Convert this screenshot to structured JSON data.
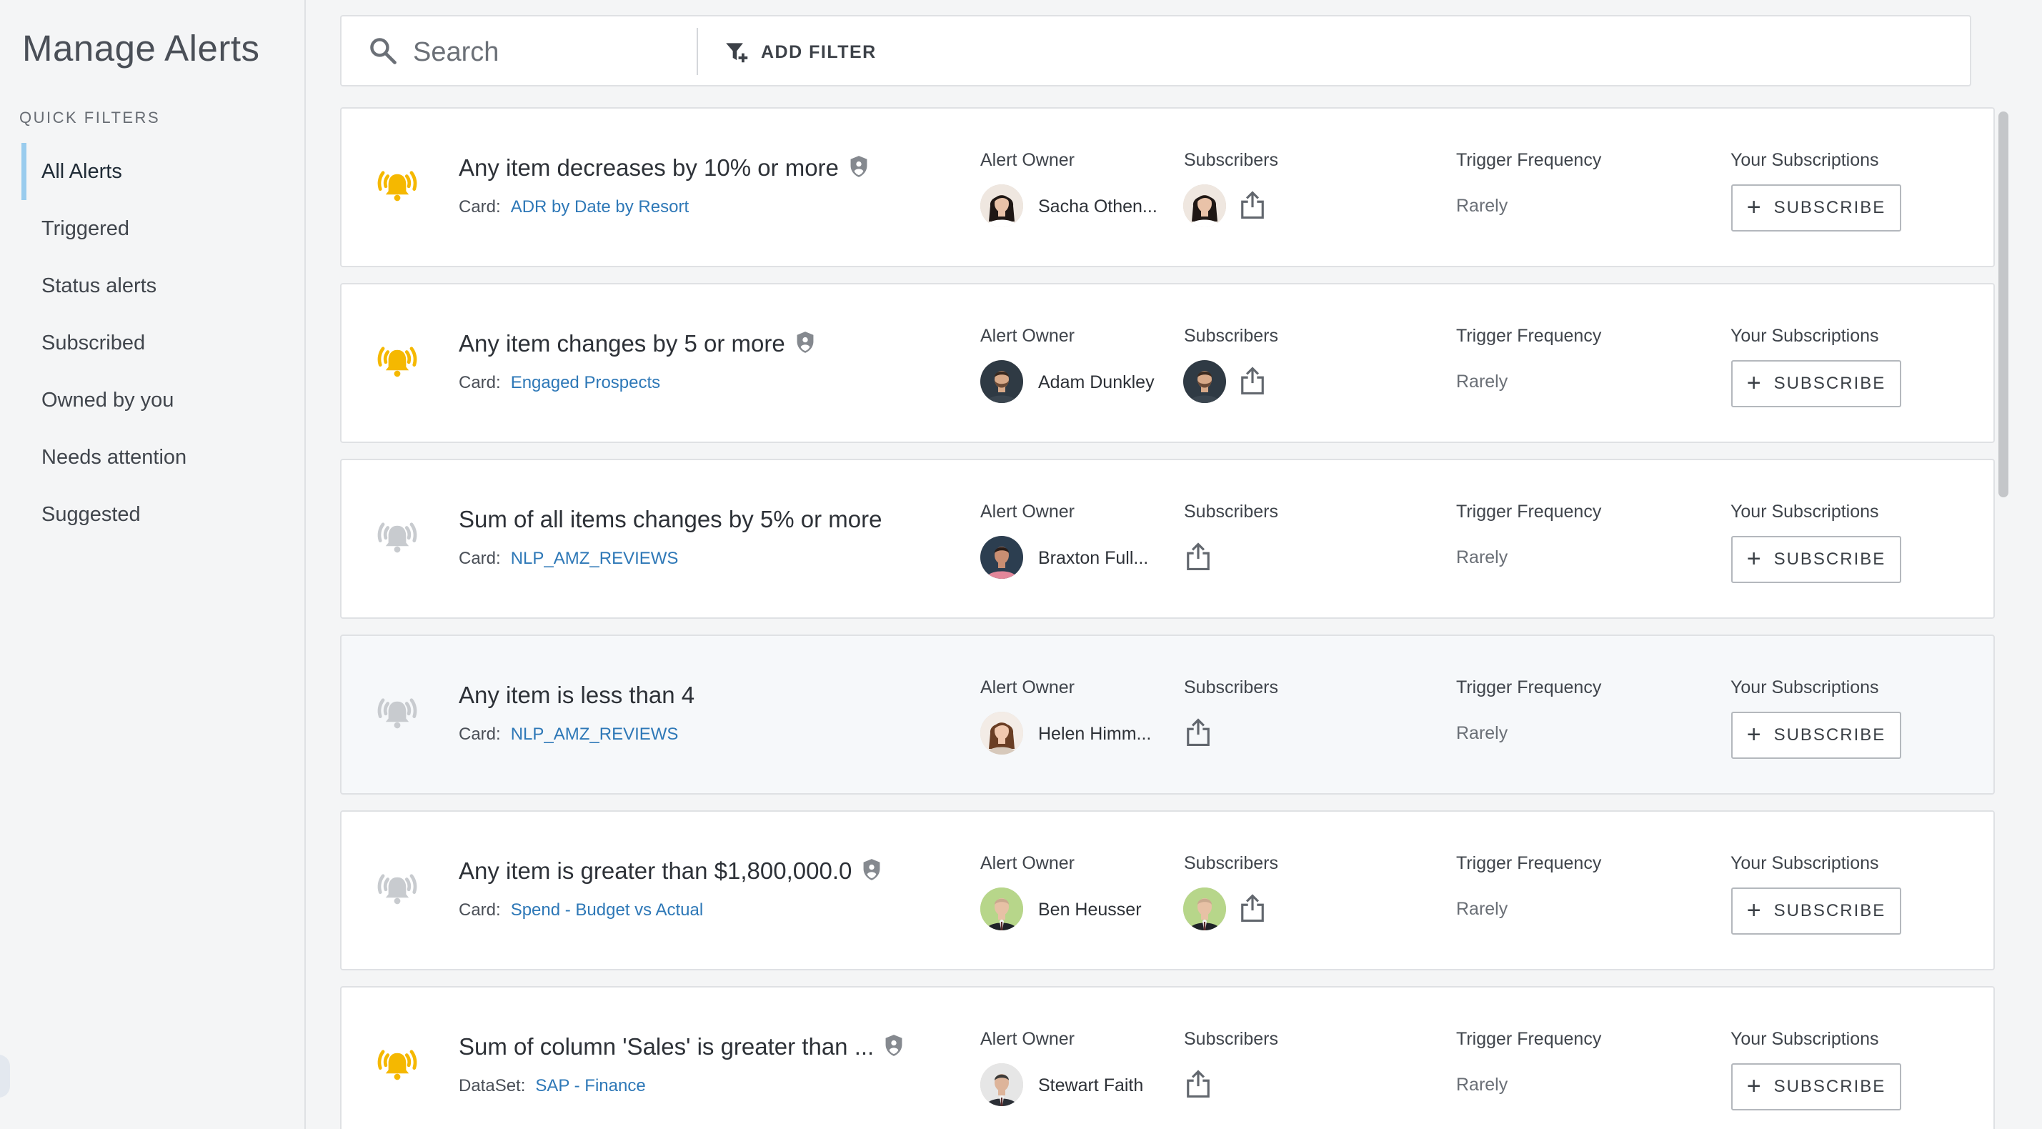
{
  "sidebar": {
    "title": "Manage Alerts",
    "quick_filters_label": "QUICK FILTERS",
    "items": [
      {
        "label": "All Alerts",
        "active": true
      },
      {
        "label": "Triggered"
      },
      {
        "label": "Status alerts"
      },
      {
        "label": "Subscribed"
      },
      {
        "label": "Owned by you"
      },
      {
        "label": "Needs attention"
      },
      {
        "label": "Suggested"
      }
    ]
  },
  "search": {
    "placeholder": "Search",
    "value": "",
    "add_filter_label": "ADD FILTER"
  },
  "column_labels": {
    "owner": "Alert Owner",
    "subscribers": "Subscribers",
    "frequency": "Trigger Frequency",
    "yours": "Your Subscriptions",
    "subscribe": "SUBSCRIBE"
  },
  "colors": {
    "bell_active": "#f5b800",
    "bell_inactive": "#c8cbcf",
    "link": "#2e78b7",
    "active_nav": "#99ccee"
  },
  "alerts": [
    {
      "title": "Any item decreases by 10% or more",
      "shield": true,
      "bell": "active",
      "prefix": "Card:",
      "source": "ADR by Date by Resort",
      "owner": "Sacha Othen...",
      "owner_avatar": "woman-dark-hair",
      "has_subscriber": true,
      "frequency": "Rarely"
    },
    {
      "title": "Any item changes by 5 or more",
      "shield": true,
      "bell": "active",
      "prefix": "Card:",
      "source": "Engaged Prospects",
      "owner": "Adam Dunkley",
      "owner_avatar": "man-beard",
      "has_subscriber": true,
      "frequency": "Rarely"
    },
    {
      "title": "Sum of all items changes by 5% or more",
      "shield": false,
      "bell": "inactive",
      "prefix": "Card:",
      "source": "NLP_AMZ_REVIEWS",
      "owner": "Braxton Full...",
      "owner_avatar": "man-pink-shirt",
      "has_subscriber": false,
      "frequency": "Rarely"
    },
    {
      "title": "Any item is less than 4",
      "shield": false,
      "bell": "inactive",
      "prefix": "Card:",
      "source": "NLP_AMZ_REVIEWS",
      "owner": "Helen Himm...",
      "owner_avatar": "woman-brown-hair",
      "has_subscriber": false,
      "frequency": "Rarely"
    },
    {
      "title": "Any item is greater than $1,800,000.0",
      "shield": true,
      "bell": "inactive",
      "prefix": "Card:",
      "source": "Spend - Budget vs Actual",
      "owner": "Ben Heusser",
      "owner_avatar": "man-bald-suit",
      "has_subscriber": true,
      "frequency": "Rarely"
    },
    {
      "title": "Sum of column 'Sales' is greater than ...",
      "shield": true,
      "bell": "active",
      "prefix": "DataSet:",
      "source": "SAP - Finance",
      "owner": "Stewart Faith",
      "owner_avatar": "man-suit",
      "has_subscriber": false,
      "frequency": "Rarely"
    }
  ]
}
